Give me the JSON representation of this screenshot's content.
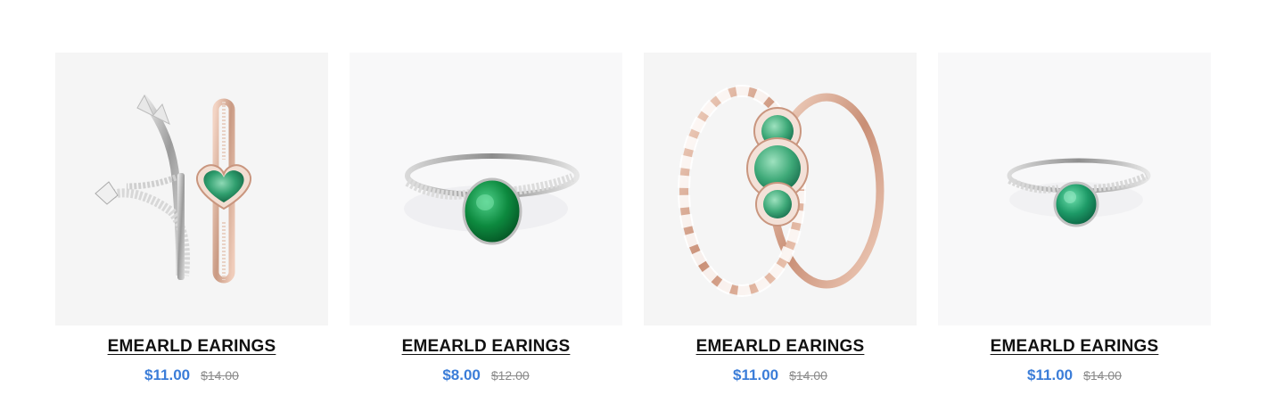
{
  "colors": {
    "title": "#111111",
    "price_now": "#3b7dd8",
    "price_was": "#8a8a8a",
    "tile_bg": "#f5f5f5",
    "emerald": "#1f8a5a"
  },
  "products": [
    {
      "image_icon": "princess-tiara-and-heart-ring-image",
      "title": "EMEARLD EARINGS",
      "price": "$11.00",
      "compare_price": "$14.00"
    },
    {
      "image_icon": "oval-emerald-solitaire-ring-image",
      "title": "EMEARLD EARINGS",
      "price": "$8.00",
      "compare_price": "$12.00"
    },
    {
      "image_icon": "rose-gold-three-stone-ring-stack-image",
      "title": "EMEARLD EARINGS",
      "price": "$11.00",
      "compare_price": "$14.00"
    },
    {
      "image_icon": "round-emerald-solitaire-ring-image",
      "title": "EMEARLD EARINGS",
      "price": "$11.00",
      "compare_price": "$14.00"
    }
  ]
}
